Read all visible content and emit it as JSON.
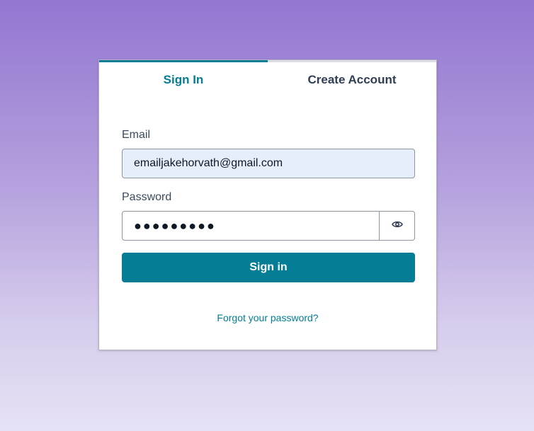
{
  "tabs": [
    {
      "label": "Sign In",
      "active": true
    },
    {
      "label": "Create Account",
      "active": false
    }
  ],
  "form": {
    "email_label": "Email",
    "email_value": "emailjakehorvath@gmail.com",
    "password_label": "Password",
    "password_value": "●●●●●●●●●",
    "show_password_icon": "eye-icon",
    "submit_label": "Sign in",
    "forgot_link": "Forgot your password?"
  },
  "colors": {
    "accent": "#047d95",
    "email_field_bg": "#e6eefb",
    "background_top": "#9376d1",
    "background_bottom": "#e6e2f5"
  }
}
